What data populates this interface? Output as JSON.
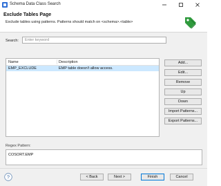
{
  "window": {
    "title": "Schema Data Class Search",
    "controls": [
      "minimize",
      "maximize",
      "close"
    ]
  },
  "header": {
    "title": "Exclude Tables Page",
    "description": "Exclude tables using patterns. Patterns should match on <schema>.<table>",
    "icon": "tag-icon",
    "icon_color": "#2f9a3d"
  },
  "search": {
    "label": "Search:",
    "placeholder": "Enter keyword",
    "value": ""
  },
  "table": {
    "columns": [
      "Name",
      "Description"
    ],
    "rows": [
      {
        "name": "EMP_EXCLUDE",
        "description": "EMP table doesn't allow access.",
        "selected": true
      }
    ],
    "selection_color": "#cce8ff"
  },
  "side_buttons": {
    "add": "Add...",
    "edit": "Edit...",
    "remove": "Remove",
    "up": "Up",
    "down": "Down",
    "import": "Import Patterns...",
    "export": "Export Patterns..."
  },
  "regex": {
    "label": "Regex Pattern:",
    "value": "COSORT.EMP"
  },
  "footer": {
    "help_icon": "help-icon",
    "back": "< Back",
    "next": "Next >",
    "finish": "Finish",
    "cancel": "Cancel"
  }
}
